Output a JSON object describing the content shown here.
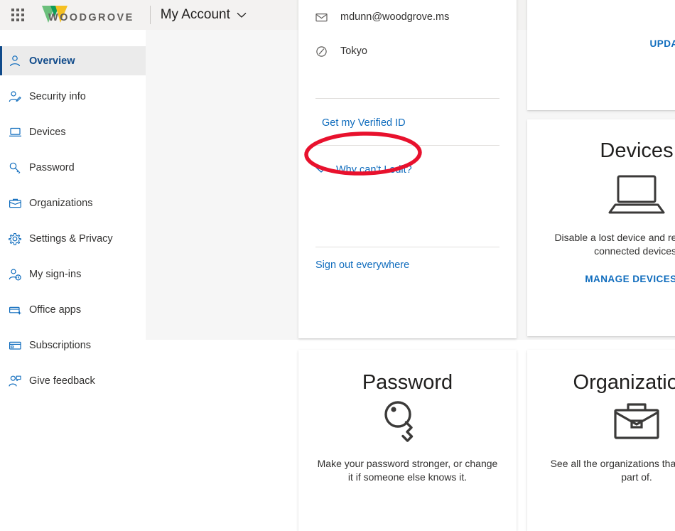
{
  "header": {
    "app_launcher_icon": "waffle-grid-icon",
    "brand_name": "WOODGROVE",
    "brand_logo_icon": "woodgrove-w-logo",
    "account_label": "My Account",
    "account_chevron_icon": "chevron-down-icon",
    "brand_green_light": "#6bbf7b",
    "brand_green_dark": "#0f9d58",
    "brand_yellow": "#f5c022"
  },
  "sidebar": {
    "items": [
      {
        "label": "Overview",
        "icon": "person-icon",
        "selected": true
      },
      {
        "label": "Security info",
        "icon": "person-edit-icon",
        "selected": false
      },
      {
        "label": "Devices",
        "icon": "laptop-icon",
        "selected": false
      },
      {
        "label": "Password",
        "icon": "key-icon",
        "selected": false
      },
      {
        "label": "Organizations",
        "icon": "briefcase-icon",
        "selected": false
      },
      {
        "label": "Settings & Privacy",
        "icon": "gear-icon",
        "selected": false
      },
      {
        "label": "My sign-ins",
        "icon": "person-clock-icon",
        "selected": false
      },
      {
        "label": "Office apps",
        "icon": "app-window-icon",
        "selected": false
      },
      {
        "label": "Subscriptions",
        "icon": "card-icon",
        "selected": false
      },
      {
        "label": "Give feedback",
        "icon": "person-feedback-icon",
        "selected": false
      }
    ],
    "selected_accent_color": "#0f4a8a",
    "icon_color": "#0f6cbd"
  },
  "profile_card": {
    "email": "mdunn@woodgrove.ms",
    "email_icon": "mail-icon",
    "timezone": "Tokyo",
    "timezone_icon": "clock-icon",
    "verified_id_link": "Get my Verified ID",
    "why_cant_i_edit_link": "Why can't I edit?",
    "why_cant_i_edit_icon": "chevron-down-icon",
    "sign_out_link": "Sign out everywhere"
  },
  "update_info_card": {
    "cta_label": "UPDATE INFO",
    "cta_icon": "chevron-right-icon"
  },
  "devices_card": {
    "title": "Devices",
    "icon": "laptop-icon",
    "description": "Disable a lost device and review your connected devices.",
    "cta_label": "MANAGE DEVICES",
    "cta_icon": "chevron-right-icon"
  },
  "password_card": {
    "title": "Password",
    "icon": "key-icon",
    "description": "Make your password stronger, or change it if someone else knows it."
  },
  "organizations_card": {
    "title": "Organizations",
    "icon": "briefcase-icon",
    "description": "See all the organizations that you are a part of."
  },
  "annotation": {
    "shape": "ellipse",
    "color": "#e8112d",
    "target": "Get my Verified ID"
  }
}
